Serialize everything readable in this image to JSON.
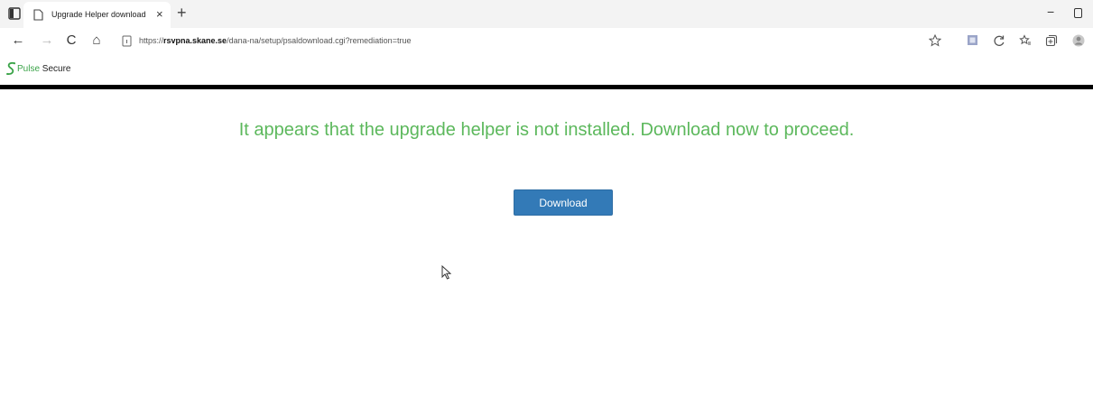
{
  "browser": {
    "tab": {
      "title": "Upgrade Helper download",
      "close_glyph": "×"
    },
    "new_tab_glyph": "+",
    "window_controls": {
      "minimize_glyph": "−"
    },
    "toolbar": {
      "back_glyph": "←",
      "forward_glyph": "→",
      "refresh_glyph": "C",
      "home_glyph": "⌂"
    },
    "address": {
      "url_prefix": "https://",
      "url_host": "rsvpna.skane.se",
      "url_path": "/dana-na/setup/psaldownload.cgi?remediation=true"
    }
  },
  "page": {
    "brand": {
      "pulse": "Pulse",
      "secure": "Secure"
    },
    "message": "It appears that the upgrade helper is not installed. Download now to proceed.",
    "download_label": "Download"
  },
  "colors": {
    "message_green": "#5cb85c",
    "button_blue": "#337ab7",
    "brand_green": "#3aa348"
  }
}
